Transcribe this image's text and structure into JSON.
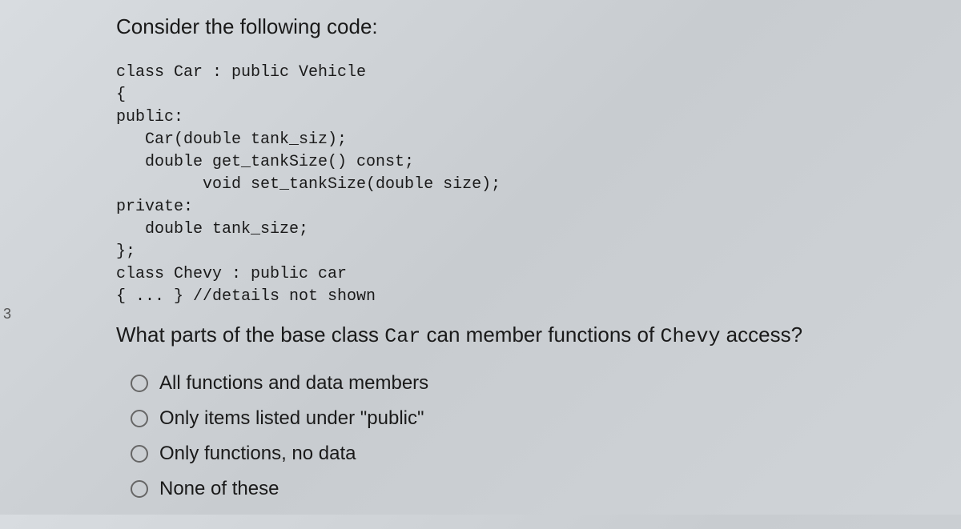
{
  "leftEdge": {
    "item1": "3"
  },
  "intro": "Consider the following code:",
  "code": "class Car : public Vehicle\n{\npublic:\n   Car(double tank_siz);\n   double get_tankSize() const;\n         void set_tankSize(double size);\nprivate:\n   double tank_size;\n};\nclass Chevy : public car\n{ ... } //details not shown",
  "question": {
    "prefix": "What parts of the base class ",
    "class1": "Car",
    "middle": " can member functions of ",
    "class2": "Chevy",
    "suffix": " access?"
  },
  "options": [
    "All functions and data members",
    "Only items listed under \"public\"",
    "Only functions, no data",
    "None of these"
  ]
}
